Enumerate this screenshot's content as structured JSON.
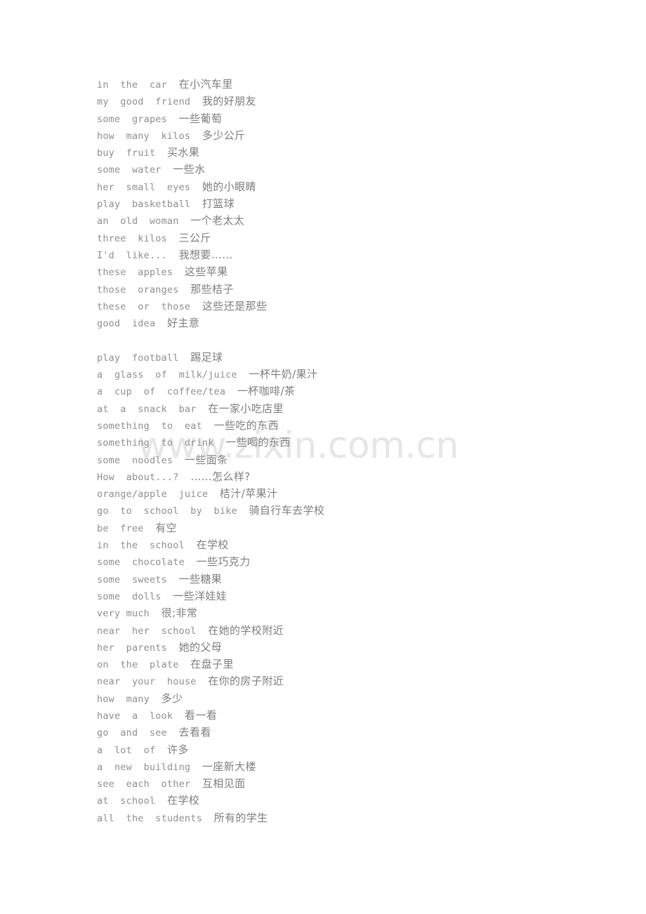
{
  "document": {
    "type": "phrase-list",
    "language_pair": "English-Chinese",
    "text_color": "#8a8a8a",
    "background_color": "#ffffff"
  },
  "watermark": {
    "text": "www.zixin.com.cn",
    "color": "#e6e6e6"
  },
  "blocks": [
    {
      "id": "block-1",
      "lines": [
        {
          "en": "in  the  car",
          "cn": "在小汽车里"
        },
        {
          "en": "my  good  friend",
          "cn": "我的好朋友"
        },
        {
          "en": "some  grapes",
          "cn": "一些葡萄"
        },
        {
          "en": "how  many  kilos",
          "cn": "多少公斤"
        },
        {
          "en": "buy  fruit",
          "cn": "买水果"
        },
        {
          "en": "some  water",
          "cn": "一些水"
        },
        {
          "en": "her  small  eyes",
          "cn": "她的小眼睛"
        },
        {
          "en": "play  basketball",
          "cn": "打篮球"
        },
        {
          "en": "an  old  woman",
          "cn": "一个老太太"
        },
        {
          "en": "three  kilos",
          "cn": "三公斤"
        },
        {
          "en": "I'd  like...",
          "cn": "我想要……"
        },
        {
          "en": "these  apples",
          "cn": "这些苹果"
        },
        {
          "en": "those  oranges",
          "cn": "那些桔子"
        },
        {
          "en": "these  or  those",
          "cn": "这些还是那些"
        },
        {
          "en": "good  idea",
          "cn": "好主意"
        }
      ]
    },
    {
      "id": "block-2",
      "lines": [
        {
          "en": "play  football",
          "cn": "踢足球"
        },
        {
          "en": "a  glass  of  milk/juice",
          "cn": "一杯牛奶/果汁"
        },
        {
          "en": "a  cup  of  coffee/tea",
          "cn": "一杯咖啡/茶"
        },
        {
          "en": "at  a  snack  bar",
          "cn": "在一家小吃店里"
        },
        {
          "en": "something  to  eat",
          "cn": "一些吃的东西"
        },
        {
          "en": "something  to  drink",
          "cn": "一些喝的东西"
        },
        {
          "en": "some  noodles",
          "cn": "一些面条"
        },
        {
          "en": "How  about...?",
          "cn": "……怎么样?"
        },
        {
          "en": "orange/apple  juice",
          "cn": "桔汁/苹果汁"
        },
        {
          "en": "go  to  school  by  bike",
          "cn": "骑自行车去学校"
        },
        {
          "en": "be  free",
          "cn": "有空"
        },
        {
          "en": "in  the  school",
          "cn": "在学校"
        },
        {
          "en": "some  chocolate",
          "cn": "一些巧克力"
        },
        {
          "en": "some  sweets",
          "cn": "一些糖果"
        },
        {
          "en": "some  dolls",
          "cn": "一些洋娃娃"
        },
        {
          "en": "very much",
          "cn": "很;非常"
        },
        {
          "en": "near  her  school",
          "cn": "在她的学校附近"
        },
        {
          "en": "her  parents",
          "cn": "她的父母"
        },
        {
          "en": "on  the  plate",
          "cn": "在盘子里"
        },
        {
          "en": "near  your  house",
          "cn": "在你的房子附近"
        },
        {
          "en": "how  many",
          "cn": "多少"
        },
        {
          "en": "have  a  look",
          "cn": "看一看"
        },
        {
          "en": "go  and  see",
          "cn": "去看看"
        },
        {
          "en": "a  lot  of",
          "cn": "许多"
        },
        {
          "en": "a  new  building",
          "cn": "一座新大楼"
        },
        {
          "en": "see  each  other",
          "cn": "互相见面"
        },
        {
          "en": "at  school",
          "cn": "在学校"
        },
        {
          "en": "all  the  students",
          "cn": "所有的学生"
        }
      ]
    }
  ]
}
